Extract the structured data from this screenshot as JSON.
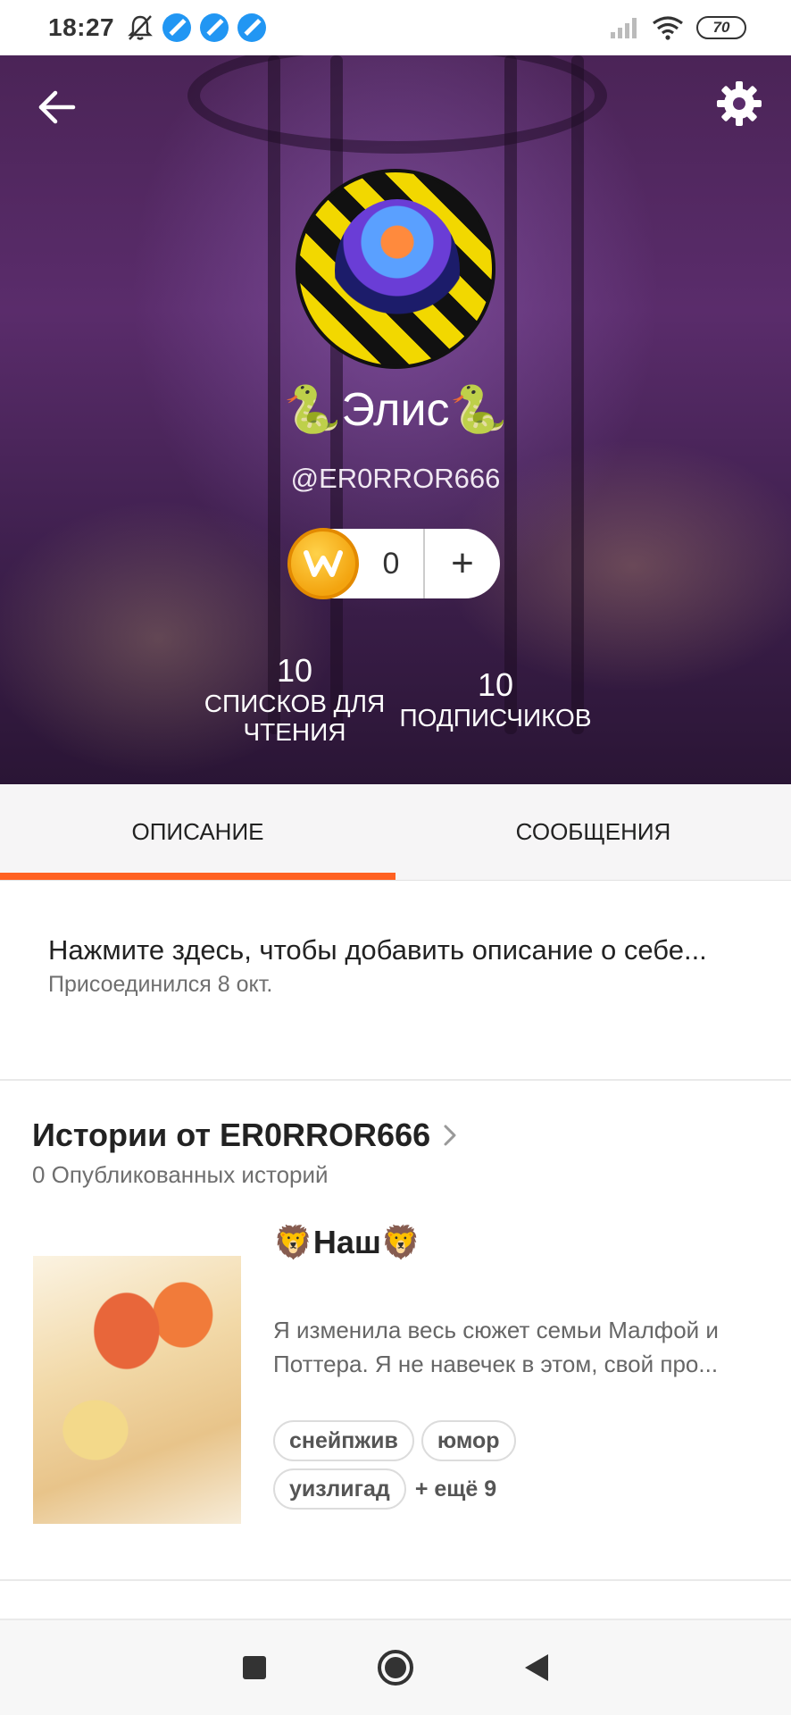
{
  "status_bar": {
    "time": "18:27",
    "battery": "70",
    "icons": [
      "bell-off-icon",
      "app-notification-icon",
      "signal-icon",
      "wifi-icon",
      "battery-icon"
    ]
  },
  "header": {
    "display_name": "🐍Элис🐍",
    "username": "@ER0RROR666",
    "coins": {
      "count": "0",
      "add_label": "+"
    },
    "stats": {
      "lists_value": "10",
      "lists_label": "СПИСКОВ ДЛЯ ЧТЕНИЯ",
      "followers_value": "10",
      "followers_label": "ПОДПИСЧИКОВ"
    }
  },
  "tabs": [
    {
      "label": "ОПИСАНИЕ",
      "active": true
    },
    {
      "label": "СООБЩЕНИЯ",
      "active": false
    }
  ],
  "description": {
    "prompt": "Нажмите здесь, чтобы добавить описание о себе...",
    "joined": "Присоединился 8 окт."
  },
  "stories": {
    "title": "Истории от ER0RROR666",
    "count": "0 Опубликованных историй",
    "items": [
      {
        "title": "🦁Наш🦁",
        "description": "Я изменила весь сюжет семьи Малфой и Поттера. Я не навечек в этом, свой про...",
        "tags": [
          "снейпжив",
          "юмор",
          "уизлигад"
        ],
        "more": "+ ещё 9"
      }
    ]
  },
  "colors": {
    "accent": "#ff6122",
    "header_bg": "#4b2457",
    "coin": "#f3a40f"
  }
}
